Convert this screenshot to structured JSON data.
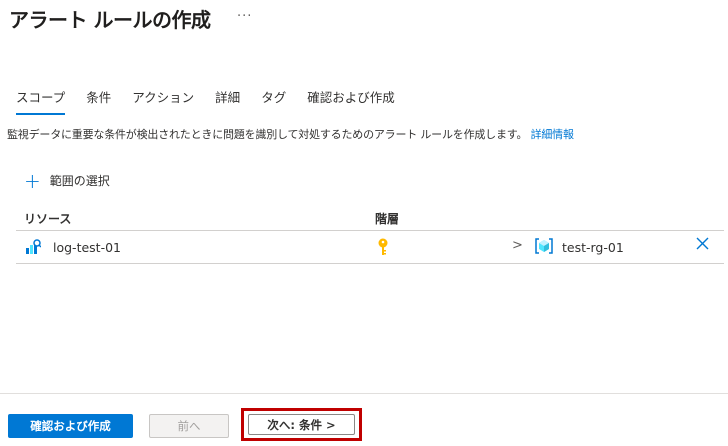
{
  "header": {
    "title": "アラート ルールの作成",
    "more_label": "···"
  },
  "tabs": [
    {
      "label": "スコープ",
      "active": true
    },
    {
      "label": "条件"
    },
    {
      "label": "アクション"
    },
    {
      "label": "詳細"
    },
    {
      "label": "タグ"
    },
    {
      "label": "確認および作成"
    }
  ],
  "description": {
    "text": "監視データに重要な条件が検出されたときに問題を識別して対処するためのアラート ルールを作成します。",
    "link": "詳細情報"
  },
  "scope": {
    "add_label": "範囲の選択"
  },
  "table": {
    "headers": {
      "resource": "リソース",
      "hierarchy": "階層"
    },
    "rows": [
      {
        "name": "log-test-01",
        "resource_group": "test-rg-01"
      }
    ]
  },
  "footer": {
    "review_create": "確認および作成",
    "previous": "前へ",
    "next": "次へ: 条件 >"
  },
  "colors": {
    "accent": "#0078d4",
    "highlight_border": "#c00000",
    "key": "#ffb900"
  },
  "icons": {
    "row": "log-analytics-icon",
    "hierarchy": "key-icon",
    "resource_group": "resource-group-icon",
    "remove": "close-icon"
  }
}
